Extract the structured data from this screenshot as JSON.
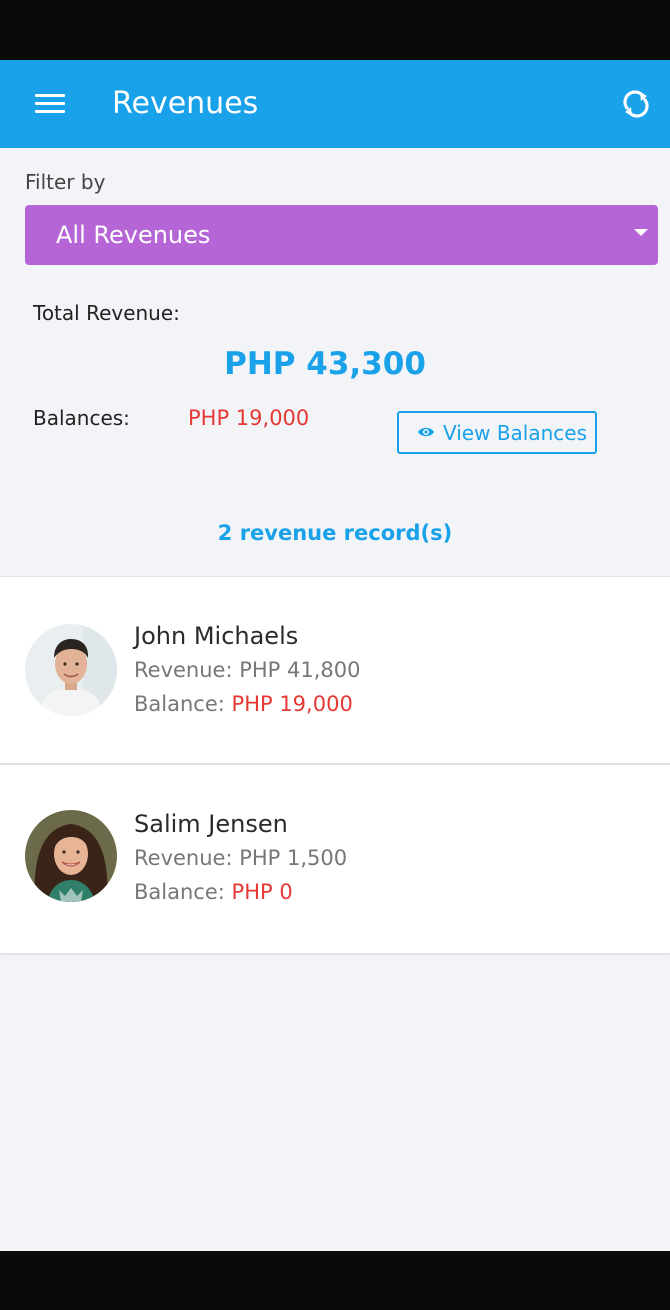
{
  "app": {
    "title": "Revenues"
  },
  "filter": {
    "label": "Filter by",
    "selected": "All Revenues"
  },
  "summary": {
    "total_label": "Total Revenue:",
    "total_value": "PHP 43,300",
    "balances_label": "Balances:",
    "balances_value": "PHP 19,000",
    "view_button": "View Balances"
  },
  "records": {
    "count_text": "2 revenue record(s)",
    "items": [
      {
        "name": "John Michaels",
        "revenue_label": "Revenue:",
        "revenue_value": "PHP 41,800",
        "balance_label": "Balance:",
        "balance_value": "PHP 19,000"
      },
      {
        "name": "Salim Jensen",
        "revenue_label": "Revenue:",
        "revenue_value": "PHP 1,500",
        "balance_label": "Balance:",
        "balance_value": "PHP 0"
      }
    ]
  },
  "colors": {
    "primary": "#19a1e9",
    "select": "#b565d6",
    "balance": "#e53935",
    "background": "#f3f4f8"
  },
  "icons": {
    "menu": "menu-icon",
    "refresh": "refresh-icon",
    "eye": "eye-icon",
    "dropdown": "caret-down-icon"
  }
}
